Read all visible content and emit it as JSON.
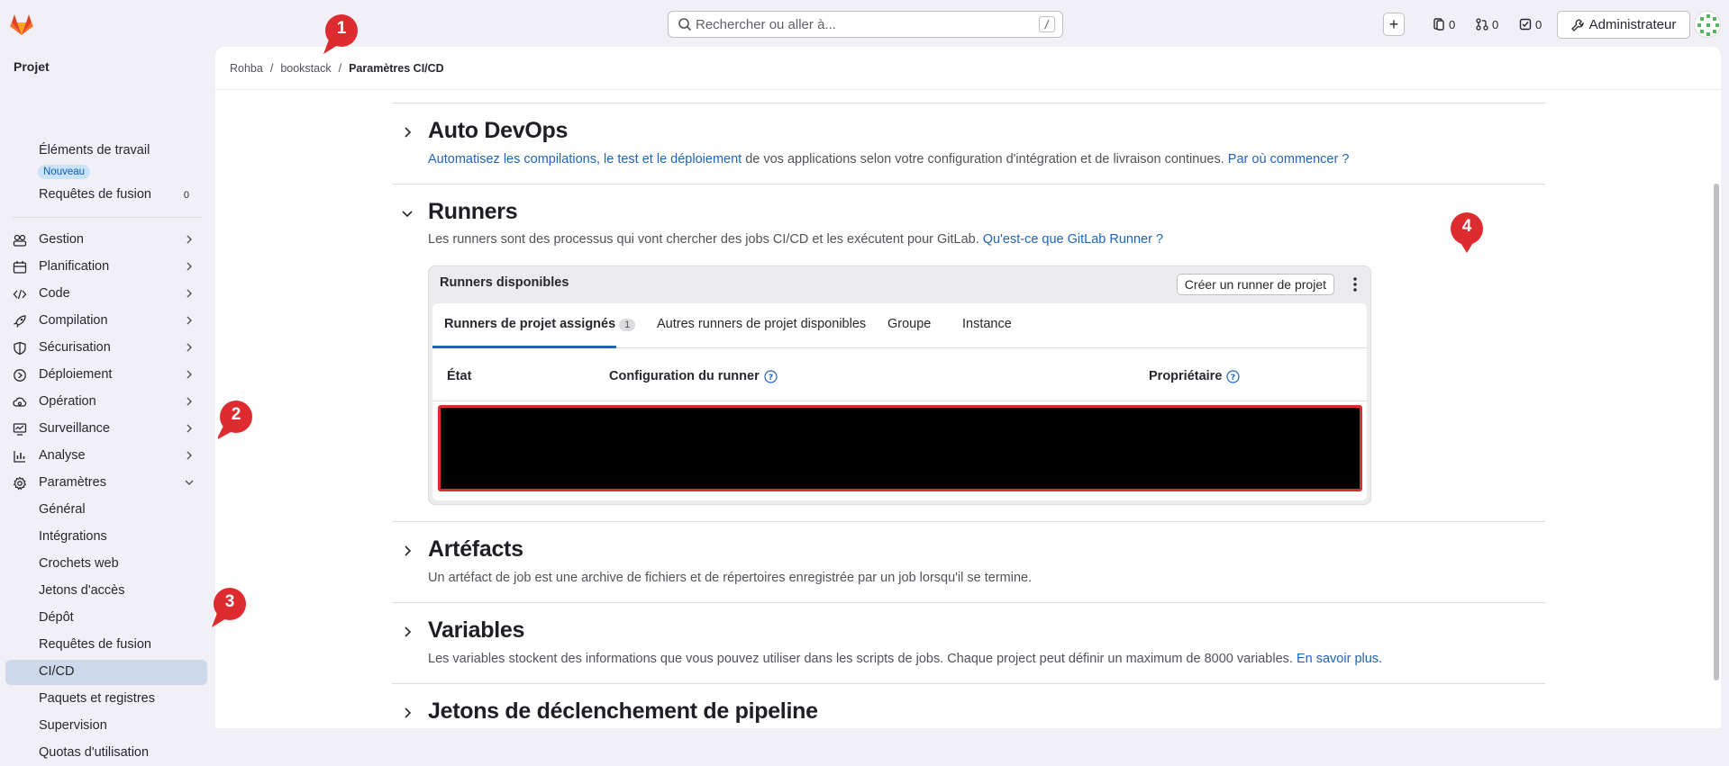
{
  "header": {
    "search_placeholder": "Rechercher ou aller à...",
    "search_shortcut": "/",
    "counter_issues": "0",
    "counter_mr": "0",
    "counter_todos": "0",
    "admin_label": "Administrateur"
  },
  "sidebar": {
    "title": "Projet",
    "items_top": [
      {
        "label": "Éléments de travail",
        "badge": "Nouveau"
      },
      {
        "label": "Requêtes de fusion",
        "count": "0"
      }
    ],
    "items": [
      {
        "label": "Gestion"
      },
      {
        "label": "Planification"
      },
      {
        "label": "Code"
      },
      {
        "label": "Compilation"
      },
      {
        "label": "Sécurisation"
      },
      {
        "label": "Déploiement"
      },
      {
        "label": "Opération"
      },
      {
        "label": "Surveillance"
      },
      {
        "label": "Analyse"
      },
      {
        "label": "Paramètres"
      }
    ],
    "sub_items": [
      {
        "label": "Général"
      },
      {
        "label": "Intégrations"
      },
      {
        "label": "Crochets web"
      },
      {
        "label": "Jetons d'accès"
      },
      {
        "label": "Dépôt"
      },
      {
        "label": "Requêtes de fusion"
      },
      {
        "label": "CI/CD"
      },
      {
        "label": "Paquets et registres"
      },
      {
        "label": "Supervision"
      },
      {
        "label": "Quotas d'utilisation"
      }
    ]
  },
  "breadcrumb": {
    "items": [
      "Rohba",
      "bookstack"
    ],
    "separator": "/",
    "current": "Paramètres CI/CD"
  },
  "sections": {
    "autodevops": {
      "title": "Auto DevOps",
      "link1": "Automatisez les compilations, le test et le déploiement",
      "text": " de vos applications selon votre configuration d'intégration et de livraison continues. ",
      "link2": "Par où commencer ?"
    },
    "runners": {
      "title": "Runners",
      "text": "Les runners sont des processus qui vont chercher des jobs CI/CD et les exécutent pour GitLab. ",
      "link": "Qu'est-ce que GitLab Runner ?",
      "card_title": "Runners disponibles",
      "create_button": "Créer un runner de projet",
      "tabs": [
        {
          "label": "Runners de projet assignés",
          "count": "1"
        },
        {
          "label": "Autres runners de projet disponibles"
        },
        {
          "label": "Groupe"
        },
        {
          "label": "Instance"
        }
      ],
      "columns": [
        "État",
        "Configuration du runner",
        "Propriétaire"
      ]
    },
    "artifacts": {
      "title": "Artéfacts",
      "text": "Un artéfact de job est une archive de fichiers et de répertoires enregistrée par un job lorsqu'il se termine."
    },
    "variables": {
      "title": "Variables",
      "text": "Les variables stockent des informations que vous pouvez utiliser dans les scripts de jobs. Chaque project peut définir un maximum de 8000 variables. ",
      "link": "En savoir plus."
    },
    "triggers": {
      "title": "Jetons de déclenchement de pipeline"
    }
  },
  "markers": [
    "1",
    "2",
    "3",
    "4"
  ],
  "colors": {
    "link": "#1f64b7",
    "marker": "#dd2b30",
    "active_nav": "#cdd8ea"
  }
}
